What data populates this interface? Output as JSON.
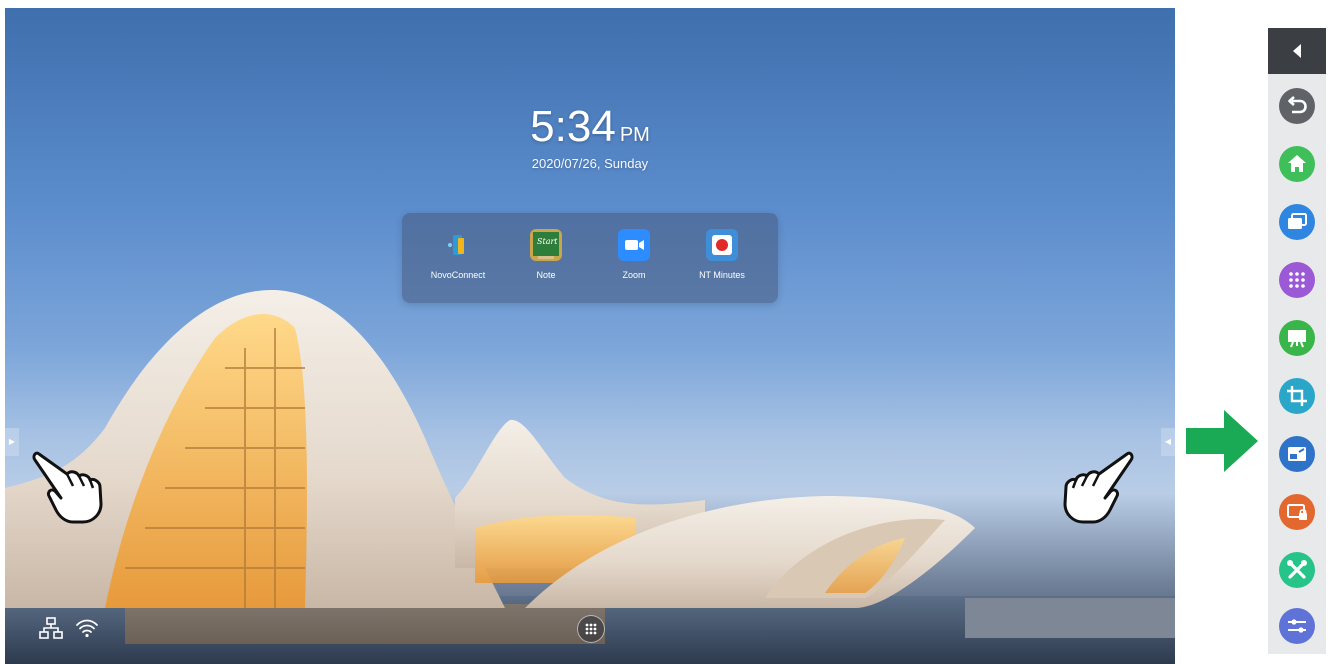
{
  "home": {
    "time": "5:34",
    "ampm": "PM",
    "date": "2020/07/26, Sunday"
  },
  "dock": {
    "apps": [
      {
        "label": "NovoConnect",
        "icon": "novoconnect-icon"
      },
      {
        "label": "Note",
        "icon": "note-icon"
      },
      {
        "label": "Zoom",
        "icon": "zoom-icon"
      },
      {
        "label": "NT Minutes",
        "icon": "nt-minutes-icon"
      }
    ]
  },
  "status_bar": {
    "icons": [
      "network-icon",
      "wifi-icon",
      "apps-grid-icon"
    ]
  },
  "toolbar": {
    "buttons": [
      {
        "name": "back",
        "icon": "back-icon",
        "color": "#5f6266"
      },
      {
        "name": "home",
        "icon": "home-icon",
        "color": "#3fbf5a"
      },
      {
        "name": "recent-apps",
        "icon": "windows-icon",
        "color": "#2f86e0"
      },
      {
        "name": "all-apps",
        "icon": "apps-grid-icon",
        "color": "#9b59d6"
      },
      {
        "name": "whiteboard",
        "icon": "whiteboard-icon",
        "color": "#39b54a"
      },
      {
        "name": "crop",
        "icon": "crop-icon",
        "color": "#2aa6c9"
      },
      {
        "name": "input-source",
        "icon": "input-source-icon",
        "color": "#2f73c9"
      },
      {
        "name": "screen-lock",
        "icon": "screen-lock-icon",
        "color": "#e2682f"
      },
      {
        "name": "tools",
        "icon": "tools-icon",
        "color": "#27c48a"
      },
      {
        "name": "settings",
        "icon": "sliders-icon",
        "color": "#5f72d8"
      }
    ]
  },
  "colors": {
    "accent_arrow": "#1aaa55",
    "toolbar_header": "#3b3f44"
  }
}
